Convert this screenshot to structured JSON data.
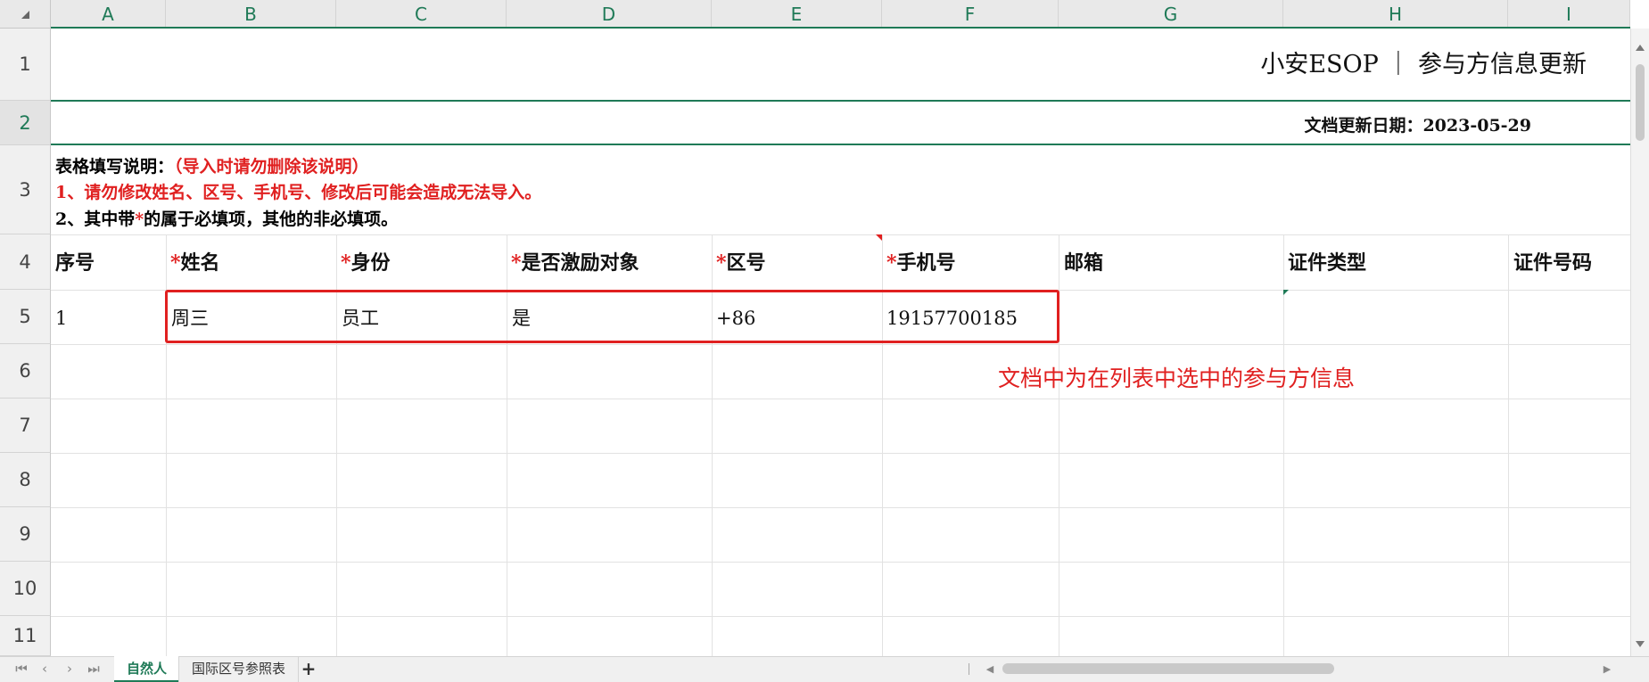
{
  "columns": [
    "A",
    "B",
    "C",
    "D",
    "E",
    "F",
    "G",
    "H",
    "I"
  ],
  "rows": [
    "1",
    "2",
    "3",
    "4",
    "5",
    "6",
    "7",
    "8",
    "9",
    "10",
    "11"
  ],
  "title": "小安ESOP ｜ 参与方信息更新",
  "update_date": "文档更新日期：2023-05-29",
  "instructions": {
    "heading": "表格填写说明：",
    "heading_note": "（导入时请勿删除该说明）",
    "line1": "1、请勿修改姓名、区号、手机号、修改后可能会造成无法导入。",
    "line2_prefix": "2、其中带",
    "line2_star": "*",
    "line2_suffix": "的属于必填项，其他的非必填项。"
  },
  "headers": [
    {
      "star": "",
      "label": "序号"
    },
    {
      "star": "*",
      "label": "姓名"
    },
    {
      "star": "*",
      "label": "身份"
    },
    {
      "star": "*",
      "label": "是否激励对象"
    },
    {
      "star": "*",
      "label": "区号"
    },
    {
      "star": "*",
      "label": "手机号"
    },
    {
      "star": "",
      "label": "邮箱"
    },
    {
      "star": "",
      "label": "证件类型"
    },
    {
      "star": "",
      "label": "证件号码"
    }
  ],
  "data_row": [
    "1",
    "周三",
    "员工",
    "是",
    "+86",
    "19157700185",
    "",
    "",
    ""
  ],
  "annotation": "文档中为在列表中选中的参与方信息",
  "sheet_tabs": [
    "自然人",
    "国际区号参照表"
  ],
  "active_tab": "自然人",
  "colors": {
    "accent": "#1f7a57",
    "highlight": "#e02020"
  }
}
